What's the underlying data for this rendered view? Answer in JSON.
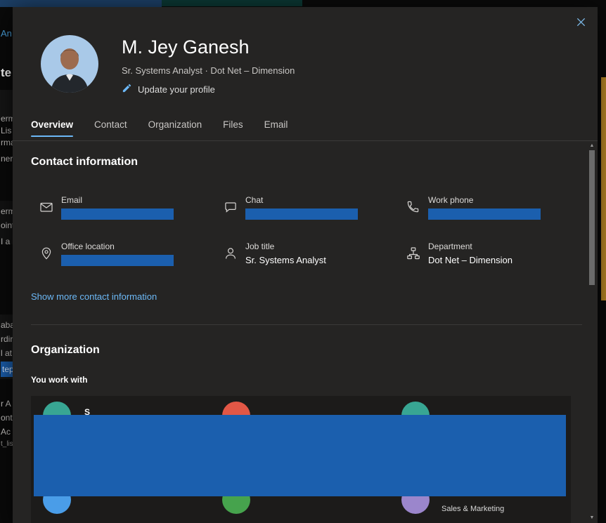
{
  "window": {
    "close_icon": "close"
  },
  "profile": {
    "name": "M. Jey Ganesh",
    "subtitle": "Sr. Systems Analyst · Dot Net – Dimension",
    "update_link": "Update your profile"
  },
  "tabs": [
    {
      "label": "Overview",
      "active": true
    },
    {
      "label": "Contact",
      "active": false
    },
    {
      "label": "Organization",
      "active": false
    },
    {
      "label": "Files",
      "active": false
    },
    {
      "label": "Email",
      "active": false
    }
  ],
  "contact": {
    "title": "Contact information",
    "show_more": "Show more contact information",
    "items": [
      {
        "label": "Email",
        "value": "",
        "redacted": true
      },
      {
        "label": "Chat",
        "value": "",
        "redacted": true
      },
      {
        "label": "Work phone",
        "value": "",
        "redacted": true
      },
      {
        "label": "Office location",
        "value": "",
        "redacted": true
      },
      {
        "label": "Job title",
        "value": "Sr. Systems Analyst",
        "redacted": false
      },
      {
        "label": "Department",
        "value": "Dot Net – Dimension",
        "redacted": false
      }
    ]
  },
  "organization": {
    "title": "Organization",
    "you_work_with": "You work with",
    "visible_name_fragment": "S",
    "visible_department": "Sales & Marketing",
    "avatars": [
      {
        "color": "#38a693"
      },
      {
        "color": "#e25746"
      },
      {
        "color": "#38a693"
      },
      {
        "color": "#4a9de8"
      },
      {
        "color": "#46a34d"
      },
      {
        "color": "#9b86cc"
      }
    ]
  },
  "colors": {
    "accent_blue": "#6cb8f6",
    "redaction_blue": "#1b5fae",
    "modal_background": "#252423"
  },
  "background": {
    "fragments": [
      {
        "text": "An"
      },
      {
        "text": "te"
      },
      {
        "text": "erm"
      },
      {
        "text": "Lis"
      },
      {
        "text": "rma"
      },
      {
        "text": "nerl"
      },
      {
        "text": "erm"
      },
      {
        "text": "oint"
      },
      {
        "text": "I a"
      },
      {
        "text": "aba"
      },
      {
        "text": "rdir"
      },
      {
        "text": "l at"
      },
      {
        "text": "tep"
      },
      {
        "text": "r A"
      },
      {
        "text": "ontu"
      },
      {
        "text": "Ac"
      },
      {
        "text": "t_lis"
      }
    ]
  }
}
